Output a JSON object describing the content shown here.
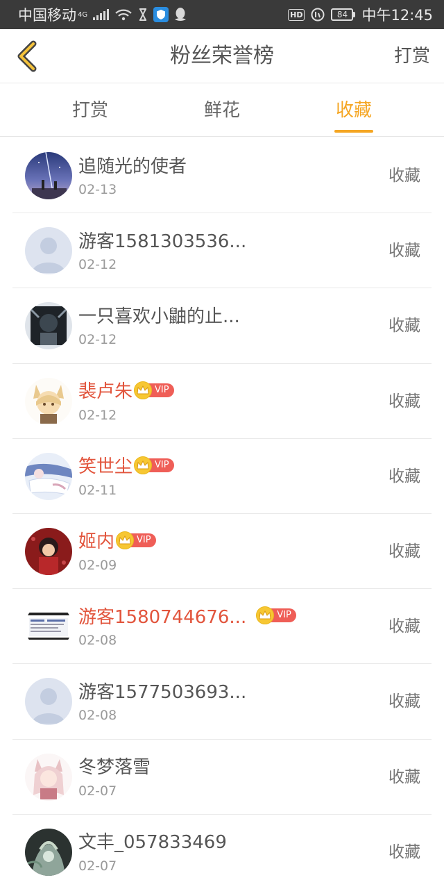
{
  "status_bar": {
    "carrier": "中国移动",
    "network": "4G",
    "battery": "84",
    "hd_label": "HD",
    "time": "中午12:45",
    "icons": [
      "signal-bars-icon",
      "wifi-icon",
      "hourglass-icon",
      "shield-app-icon",
      "penguin-icon",
      "hd-icon",
      "volte-icon",
      "battery-icon"
    ]
  },
  "nav": {
    "title": "粉丝荣誉榜",
    "right_action": "打赏",
    "back_icon": "chevron-left-icon"
  },
  "tabs": [
    {
      "label": "打赏",
      "active": false
    },
    {
      "label": "鲜花",
      "active": false
    },
    {
      "label": "收藏",
      "active": true
    }
  ],
  "vip_label": "VIP",
  "fans": [
    {
      "name": "追随光的使者",
      "date": "02-13",
      "action": "收藏",
      "vip": false,
      "avatar": "night-sky"
    },
    {
      "name": "游客1581303536...",
      "date": "02-12",
      "action": "收藏",
      "vip": false,
      "avatar": "default"
    },
    {
      "name": "一只喜欢小鼬的止...",
      "date": "02-12",
      "action": "收藏",
      "vip": false,
      "avatar": "dark"
    },
    {
      "name": "裴卢朱",
      "date": "02-12",
      "action": "收藏",
      "vip": true,
      "avatar": "anime-fox"
    },
    {
      "name": "笑世尘",
      "date": "02-11",
      "action": "收藏",
      "vip": true,
      "avatar": "anime-blue"
    },
    {
      "name": "姬内",
      "date": "02-09",
      "action": "收藏",
      "vip": true,
      "avatar": "red"
    },
    {
      "name": "游客1580744676...",
      "date": "02-08",
      "action": "收藏",
      "vip": true,
      "avatar": "screenshot"
    },
    {
      "name": "游客1577503693...",
      "date": "02-08",
      "action": "收藏",
      "vip": false,
      "avatar": "default"
    },
    {
      "name": "冬梦落雪",
      "date": "02-07",
      "action": "收藏",
      "vip": false,
      "avatar": "anime-pink"
    },
    {
      "name": "文丰_057833469",
      "date": "02-07",
      "action": "收藏",
      "vip": false,
      "avatar": "green-dark"
    }
  ],
  "colors": {
    "accent": "#f5a623",
    "vip_name": "#e2553d",
    "vip_tag": "#ef5e57",
    "status_bar": "#3a3a3a"
  }
}
